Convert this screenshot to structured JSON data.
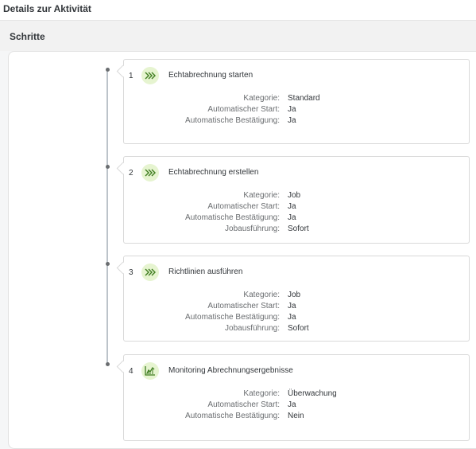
{
  "header": {
    "title": "Details zur Aktivität"
  },
  "section": {
    "title": "Schritte"
  },
  "colors": {
    "accent_bg": "#e6f4d0",
    "accent_icon": "#3e7c1f"
  },
  "steps": [
    {
      "number": "1",
      "icon": "chevrons-forward-icon",
      "title": "Echtabrechnung starten",
      "props": [
        {
          "label": "Kategorie:",
          "value": "Standard"
        },
        {
          "label": "Automatischer Start:",
          "value": "Ja"
        },
        {
          "label": "Automatische Bestätigung:",
          "value": "Ja"
        }
      ]
    },
    {
      "number": "2",
      "icon": "chevrons-forward-icon",
      "title": "Echtabrechnung erstellen",
      "props": [
        {
          "label": "Kategorie:",
          "value": "Job"
        },
        {
          "label": "Automatischer Start:",
          "value": "Ja"
        },
        {
          "label": "Automatische Bestätigung:",
          "value": "Ja"
        },
        {
          "label": "Jobausführung:",
          "value": "Sofort"
        }
      ]
    },
    {
      "number": "3",
      "icon": "chevrons-forward-icon",
      "title": "Richtlinien ausführen",
      "props": [
        {
          "label": "Kategorie:",
          "value": "Job"
        },
        {
          "label": "Automatischer Start:",
          "value": "Ja"
        },
        {
          "label": "Automatische Bestätigung:",
          "value": "Ja"
        },
        {
          "label": "Jobausführung:",
          "value": "Sofort"
        }
      ]
    },
    {
      "number": "4",
      "icon": "monitoring-chart-icon",
      "title": "Monitoring Abrechnungsergebnisse",
      "props": [
        {
          "label": "Kategorie:",
          "value": "Überwachung"
        },
        {
          "label": "Automatischer Start:",
          "value": "Ja"
        },
        {
          "label": "Automatische Bestätigung:",
          "value": "Nein"
        }
      ]
    }
  ]
}
